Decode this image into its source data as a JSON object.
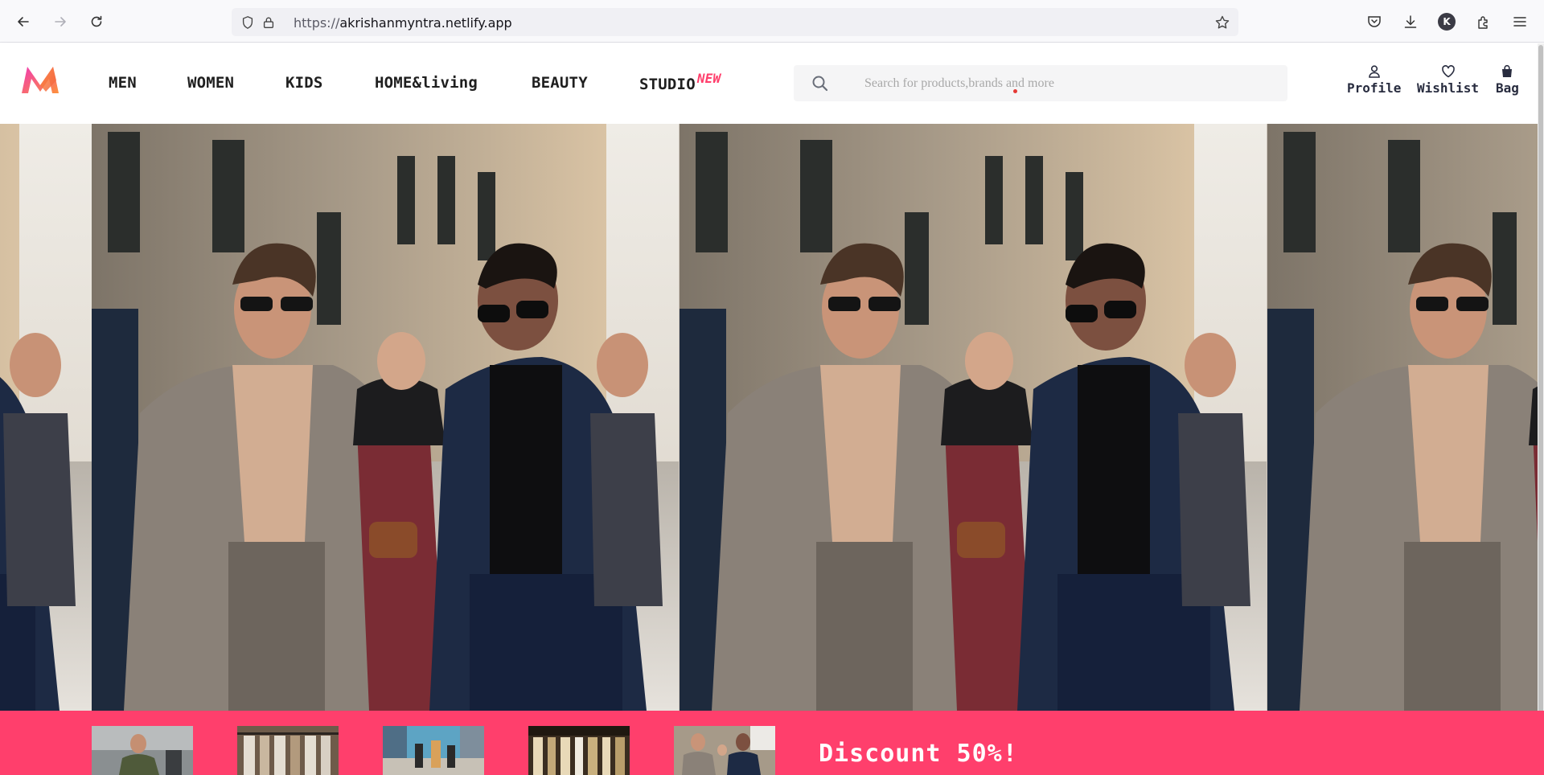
{
  "browser": {
    "url_scheme": "https://",
    "url_host": "akrishanmyntra.netlify.app",
    "profile_initial": "K",
    "icons": [
      "back-icon",
      "forward-icon",
      "reload-icon",
      "shield-icon",
      "lock-icon",
      "star-icon",
      "pocket-icon",
      "download-icon",
      "extensions-icon",
      "menu-icon"
    ]
  },
  "header": {
    "logo": "myntra-logo",
    "nav": [
      "MEN",
      "WOMEN",
      "KIDS",
      "HOME&living",
      "BEAUTY",
      "STUDIO"
    ],
    "studio_badge": "NEW",
    "search_placeholder": "Search for products,brands and more",
    "actions": {
      "profile": "Profile",
      "wishlist": "Wishlist",
      "bag": "Bag"
    }
  },
  "hero": {
    "image": "men-street-fashion-banner",
    "repeat": 4
  },
  "promo": {
    "thumbnails": [
      "man-coat-thumbnail",
      "clothing-rack-thumbnail",
      "street-crowd-thumbnail",
      "boutique-thumbnail",
      "men-walking-thumbnail"
    ],
    "discount_text": "Discount 50%!"
  },
  "colors": {
    "brand_pink": "#ff3f6c",
    "logo_orange": "#f13ab1",
    "header_text": "#282c3f"
  }
}
